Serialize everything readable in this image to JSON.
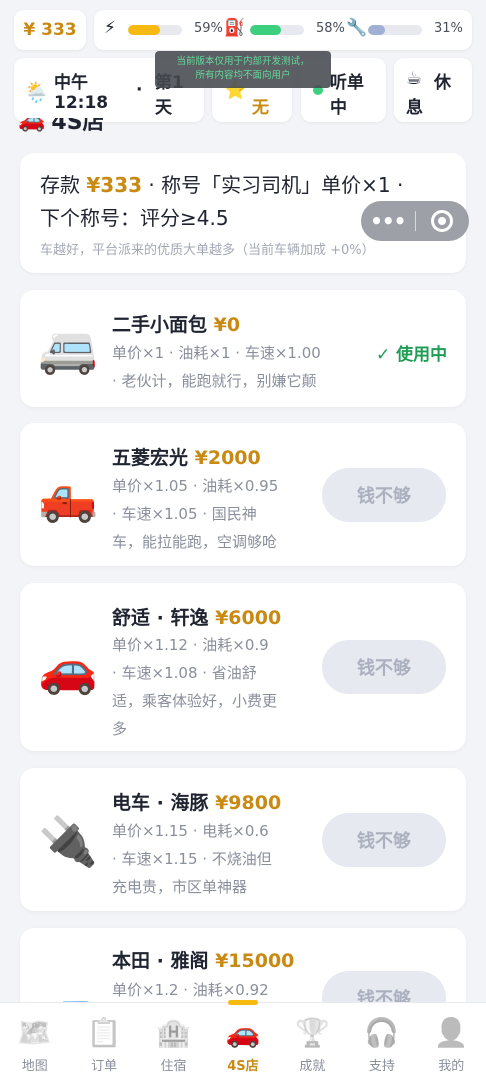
{
  "status": {
    "money": "¥ 333",
    "energy_icon": "⚡",
    "energy_pct": "59%",
    "energy_level": 0.59,
    "fuel_icon": "⛽",
    "fuel_pct": "58%",
    "fuel_level": 0.58,
    "repair_icon": "🔧",
    "repair_pct": "31%",
    "repair_level": 0.31,
    "colors": {
      "energy": "#f5b90f",
      "fuel": "#3ccf7e",
      "repair": "#9fb0d4"
    }
  },
  "info": {
    "weather_icon": "🌦️",
    "time_period": "中午",
    "time": "12:18",
    "dot": "·",
    "day_line1": "第1",
    "day_line2": "天",
    "event_icon": "⭐",
    "event_line1": "",
    "event_line2": "无",
    "order_dot_color": "#3ccf7e",
    "order_line1": "听单",
    "order_line2": "中",
    "rest_icon": "☕",
    "rest_line1": "休",
    "rest_line2": "息"
  },
  "toast": {
    "line1": "当前版本仅用于内部开发测试，",
    "line2": "所有内容均不面向用户"
  },
  "section": {
    "icon": "🚗",
    "title": "4S店"
  },
  "summary": {
    "deposit_label": "存款",
    "deposit_value": "¥333",
    "title_part": " · 称号「实习司机」单价×1 ·",
    "next_title": "下个称号：评分≥4.5",
    "hint": "车越好，平台派来的优质大单越多（当前车辆加成 +0%）"
  },
  "capsule": {
    "more": "•••"
  },
  "cars": [
    {
      "emoji": "🚐",
      "name": "二手小面包",
      "price": "¥0",
      "desc": "单价×1 · 油耗×1 · 车速×1.00\n· 老伙计，能跑就行，别嫌它颠",
      "status": "✓ 使用中"
    },
    {
      "emoji": "🛻",
      "name": "五菱宏光",
      "price": "¥2000",
      "desc": "单价×1.05 · 油耗×0.95\n· 车速×1.05 · 国民神\n车，能拉能跑，空调够呛",
      "status": "钱不够"
    },
    {
      "emoji": "🚗",
      "name": "舒适 · 轩逸",
      "price": "¥6000",
      "desc": "单价×1.12 · 油耗×0.9\n· 车速×1.08 · 省油舒\n适，乘客体验好，小费更\n多",
      "status": "钱不够"
    },
    {
      "emoji": "🔌",
      "name": "电车 · 海豚",
      "price": "¥9800",
      "desc": "单价×1.15 · 电耗×0.6\n· 车速×1.15 · 不烧油但\n充电贵，市区单神器",
      "status": "钱不够"
    },
    {
      "emoji": "🚙",
      "name": "本田 · 雅阁",
      "price": "¥15000",
      "desc": "单价×1.2 · 油耗×0.92",
      "status": "钱不够"
    }
  ],
  "tabs": [
    {
      "icon": "🗺️",
      "label": "地图"
    },
    {
      "icon": "📋",
      "label": "订单"
    },
    {
      "icon": "🏨",
      "label": "住宿"
    },
    {
      "icon": "🚗",
      "label": "4S店"
    },
    {
      "icon": "🏆",
      "label": "成就"
    },
    {
      "icon": "🎧",
      "label": "支持"
    },
    {
      "icon": "👤",
      "label": "我的"
    }
  ]
}
